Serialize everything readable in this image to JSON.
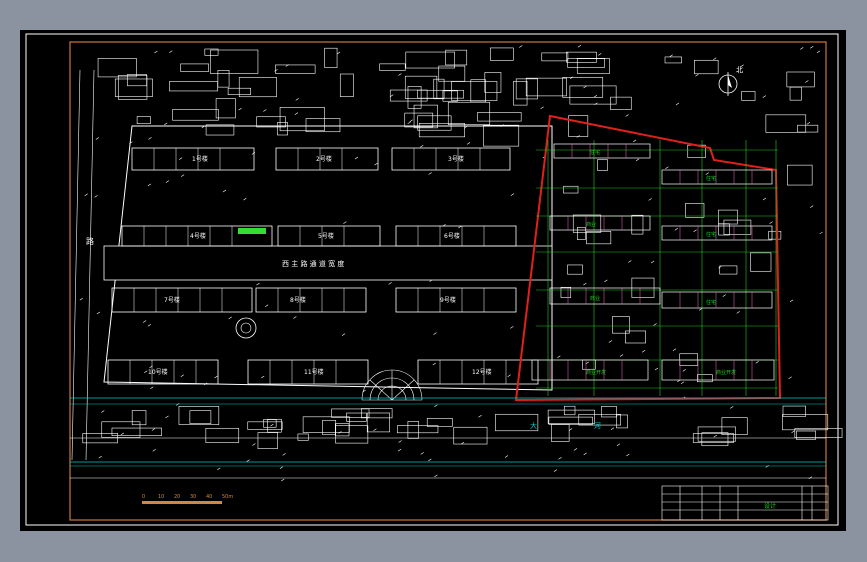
{
  "colors": {
    "background": "#000000",
    "frame": "#c8773a",
    "linework": "#ffffff",
    "boundary": "#e0201c",
    "grid": "#22cc22",
    "road": "#00c8c8",
    "scale_bar": "#d08840"
  },
  "site_plan": {
    "north_label": "北",
    "central_road_label": "西 主 路 通 道 宽 度",
    "street_label": "路",
    "river_label_1": "大",
    "river_label_2": "河",
    "existing_buildings": [
      {
        "label": "1号楼"
      },
      {
        "label": "2号楼"
      },
      {
        "label": "3号楼"
      },
      {
        "label": "4号楼"
      },
      {
        "label": "5号楼"
      },
      {
        "label": "6号楼"
      },
      {
        "label": "7号楼"
      },
      {
        "label": "8号楼"
      },
      {
        "label": "9号楼"
      },
      {
        "label": "10号楼"
      },
      {
        "label": "11号楼"
      },
      {
        "label": "12号楼"
      }
    ],
    "new_block_labels": [
      {
        "label": "住宅"
      },
      {
        "label": "住宅"
      },
      {
        "label": "商业"
      },
      {
        "label": "住宅"
      },
      {
        "label": "商业"
      },
      {
        "label": "住宅"
      },
      {
        "label": "商业开发"
      },
      {
        "label": "商业开发"
      }
    ]
  },
  "scale_bar": {
    "ticks": [
      "0",
      "10",
      "20",
      "30",
      "40",
      "50m"
    ]
  },
  "title_block": {
    "stamp": "设计"
  }
}
